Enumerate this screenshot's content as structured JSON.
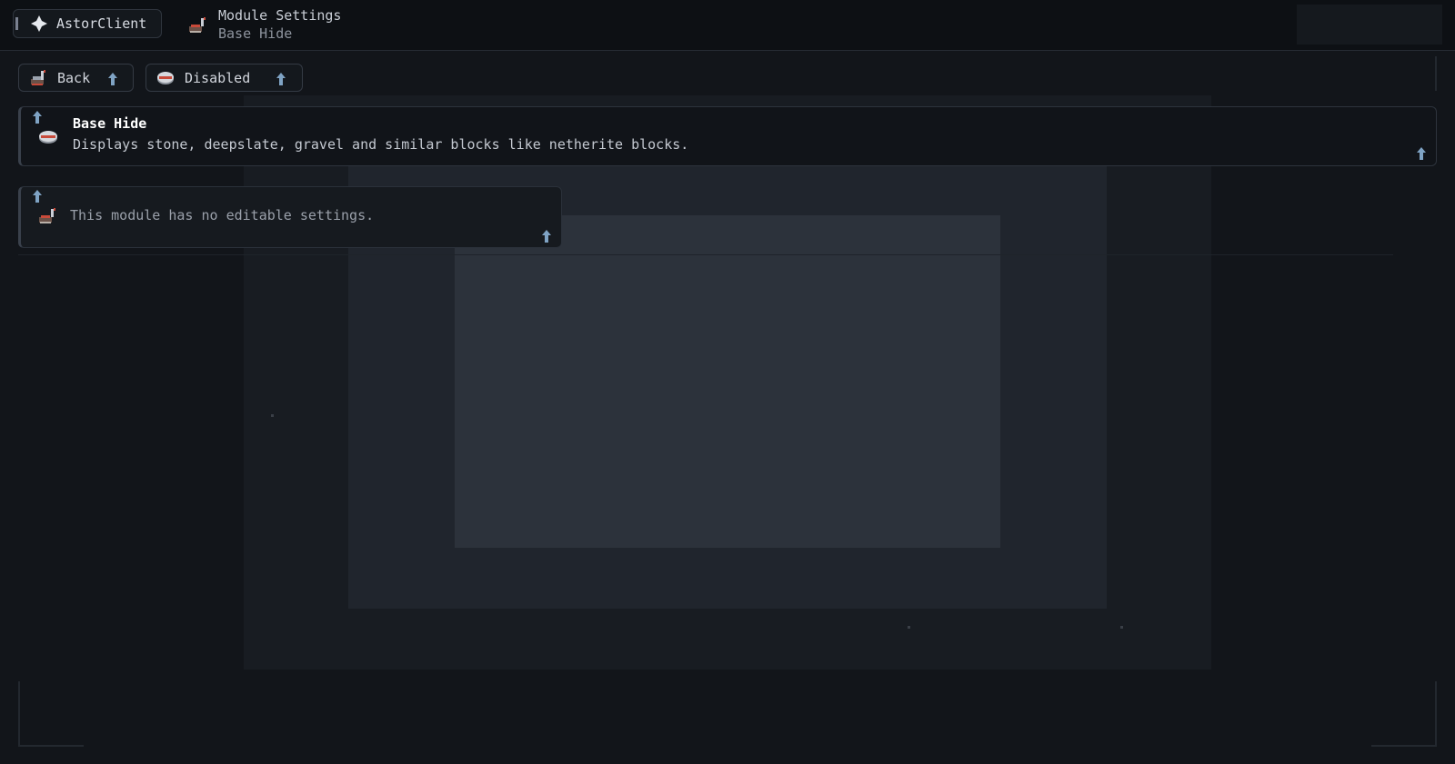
{
  "app": {
    "brand_label": "AstorClient"
  },
  "breadcrumb": {
    "title": "Module Settings",
    "subtitle": "Base Hide"
  },
  "toolbar": {
    "back_label": "Back",
    "toggle_label": "Disabled"
  },
  "module": {
    "name": "Base Hide",
    "description": "Displays stone, deepslate, gravel and similar blocks like netherite blocks."
  },
  "settings": {
    "empty_message": "This module has no editable settings."
  },
  "icons": {
    "brand": "diamond-icon",
    "module": "wrench-icon",
    "back": "back-icon",
    "toggle": "toggle-icon",
    "pin": "pin-icon"
  },
  "colors": {
    "background": "#101317",
    "accent_pin": "#7fa3c4",
    "module_icon_red": "#c84a3a"
  }
}
